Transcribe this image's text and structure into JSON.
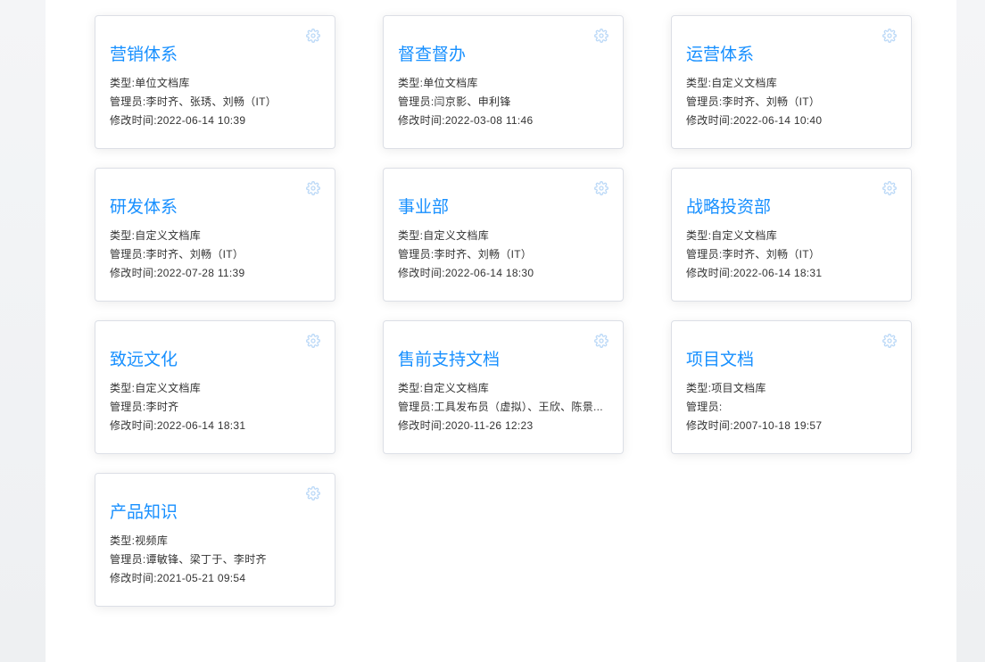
{
  "colors": {
    "title": "#1890ff",
    "gear": "#bcd9f7"
  },
  "cards": [
    {
      "title": "营销体系",
      "type": "类型:单位文档库",
      "admins": "管理员:李时齐、张琇、刘畅（IT）",
      "modified": "修改时间:2022-06-14 10:39",
      "icon": "gear-icon"
    },
    {
      "title": "督查督办",
      "type": "类型:单位文档库",
      "admins": "管理员:闫京影、申利锋",
      "modified": "修改时间:2022-03-08 11:46",
      "icon": "gear-icon"
    },
    {
      "title": "运营体系",
      "type": "类型:自定义文档库",
      "admins": "管理员:李时齐、刘畅（IT）",
      "modified": "修改时间:2022-06-14 10:40",
      "icon": "gear-icon"
    },
    {
      "title": "研发体系",
      "type": "类型:自定义文档库",
      "admins": "管理员:李时齐、刘畅（IT）",
      "modified": "修改时间:2022-07-28 11:39",
      "icon": "gear-icon"
    },
    {
      "title": "事业部",
      "type": "类型:自定义文档库",
      "admins": "管理员:李时齐、刘畅（IT）",
      "modified": "修改时间:2022-06-14 18:30",
      "icon": "gear-icon"
    },
    {
      "title": "战略投资部",
      "type": "类型:自定义文档库",
      "admins": "管理员:李时齐、刘畅（IT）",
      "modified": "修改时间:2022-06-14 18:31",
      "icon": "gear-icon"
    },
    {
      "title": "致远文化",
      "type": "类型:自定义文档库",
      "admins": "管理员:李时齐",
      "modified": "修改时间:2022-06-14 18:31",
      "icon": "gear-icon"
    },
    {
      "title": "售前支持文档",
      "type": "类型:自定义文档库",
      "admins": "管理员:工具发布员（虚拟）、王欣、陈景...",
      "modified": "修改时间:2020-11-26 12:23",
      "icon": "gear-icon"
    },
    {
      "title": "项目文档",
      "type": "类型:项目文档库",
      "admins": "管理员:",
      "modified": "修改时间:2007-10-18 19:57",
      "icon": "gear-icon"
    },
    {
      "title": "产品知识",
      "type": "类型:视频库",
      "admins": "管理员:谭敏锋、梁丁于、李时齐",
      "modified": "修改时间:2021-05-21 09:54",
      "icon": "gear-icon"
    }
  ]
}
